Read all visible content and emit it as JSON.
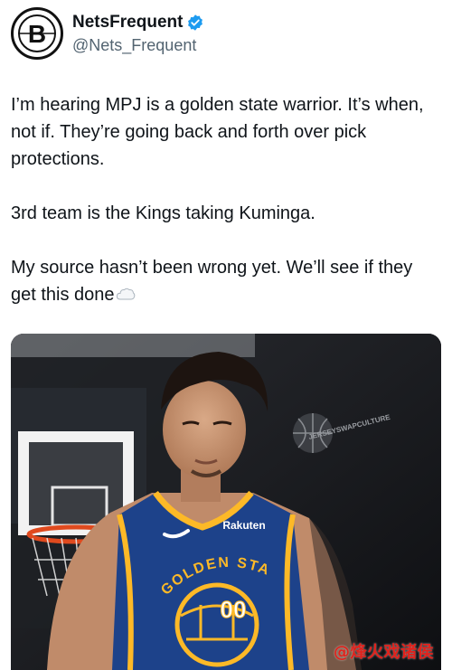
{
  "tweet": {
    "author": {
      "display_name": "NetsFrequent",
      "handle": "@Nets_Frequent",
      "verified": true,
      "avatar_icon": "nets-b-logo-icon",
      "avatar_letter": "B"
    },
    "paragraphs": [
      "I’m hearing MPJ is a golden state warrior. It’s when, not if. They’re going back and forth over pick protections.",
      "3rd team is the Kings taking Kuminga.",
      "My source hasn’t been wrong yet. We’ll see if they get this done"
    ],
    "trailing_emoji": "cloud-icon"
  },
  "media": {
    "jersey_sponsor": "Rakuten",
    "jersey_team_text": "GOLDEN STATE",
    "jersey_number": "00",
    "image_watermark": "JERSEYSWAPCULTURE",
    "corner_watermark": "@烽火戏诸侯"
  },
  "colors": {
    "verified_blue": "#1d9bf0",
    "warriors_blue": "#1d428a",
    "warriors_gold": "#fdb927",
    "watermark_red": "#e0221c"
  }
}
